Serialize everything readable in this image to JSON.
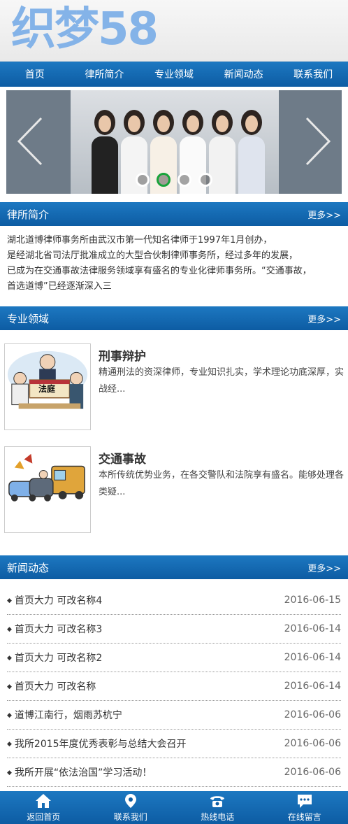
{
  "header": {
    "logo_text": "织梦58"
  },
  "nav": {
    "items": [
      "首页",
      "律所简介",
      "专业领域",
      "新闻动态",
      "联系我们"
    ]
  },
  "banner": {
    "slide_count": 4,
    "active_index": 1
  },
  "about": {
    "title": "律所简介",
    "more": "更多>>",
    "lines": [
      "湖北道博律师事务所由武汉市第一代知名律师于1997年1月创办，",
      "是经湖北省司法厅批准成立的大型合伙制律师事务所，经过多年的发展，",
      "已成为在交通事故法律服务领域享有盛名的专业化律师事务所。“交通事故，",
      "首选道博”已经逐渐深入三"
    ]
  },
  "services": {
    "title": "专业领域",
    "more": "更多>>",
    "items": [
      {
        "name": "刑事辩护",
        "desc": "精通刑法的资深律师，专业知识扎实，学术理论功底深厚，实战经...",
        "thumb_text": "法庭"
      },
      {
        "name": "交通事故",
        "desc": "本所传统优势业务，在各交警队和法院享有盛名。能够处理各类疑..."
      }
    ]
  },
  "news": {
    "title": "新闻动态",
    "more": "更多>>",
    "items": [
      {
        "title": "首页大力 可改名称4",
        "date": "2016-06-15"
      },
      {
        "title": "首页大力 可改名称3",
        "date": "2016-06-14"
      },
      {
        "title": "首页大力 可改名称2",
        "date": "2016-06-14"
      },
      {
        "title": "首页大力 可改名称",
        "date": "2016-06-14"
      },
      {
        "title": "道博江南行，烟雨苏杭宁",
        "date": "2016-06-06"
      },
      {
        "title": "我所2015年度优秀表彰与总结大会召开",
        "date": "2016-06-06"
      },
      {
        "title": "我所开展“依法治国”学习活动！",
        "date": "2016-06-06"
      }
    ]
  },
  "footer": {
    "items": [
      {
        "label": "返回首页",
        "icon": "home-icon"
      },
      {
        "label": "联系我们",
        "icon": "location-pin-icon"
      },
      {
        "label": "热线电话",
        "icon": "telephone-icon"
      },
      {
        "label": "在线留言",
        "icon": "chat-bubble-icon"
      }
    ]
  },
  "colors": {
    "primary": "#0d5ca3",
    "primary_light": "#1d78c1",
    "active_dot": "#18a33a"
  }
}
